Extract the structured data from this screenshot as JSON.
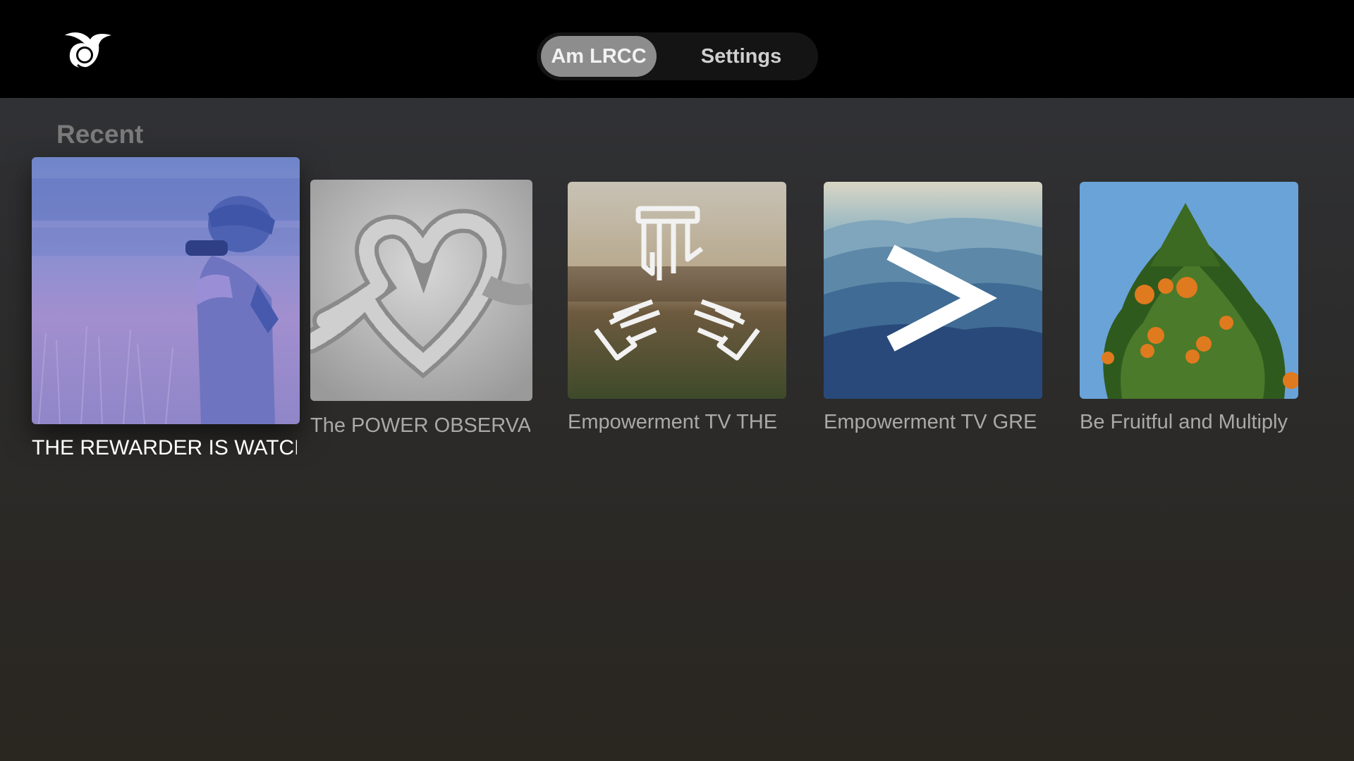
{
  "header": {
    "logo_icon": "dove-icon",
    "tabs": [
      {
        "label": "Am LRCC",
        "selected": true
      },
      {
        "label": "Settings",
        "selected": false
      }
    ]
  },
  "recent": {
    "title": "Recent",
    "items": [
      {
        "title": "THE REWARDER IS WATCH",
        "artwork": "child-binoculars-image",
        "focused": true
      },
      {
        "title": "The POWER OBSERVA",
        "artwork": "rope-heart-knot-image",
        "focused": false
      },
      {
        "title": "Empowerment TV THE",
        "artwork": "helping-hands-image",
        "focused": false
      },
      {
        "title": "Empowerment TV GRE",
        "artwork": "mountains-chevron-image",
        "focused": false
      },
      {
        "title": "Be Fruitful and Multiply",
        "artwork": "orange-tree-image",
        "focused": false
      }
    ]
  },
  "colors": {
    "topbar": "#000000",
    "active_tab": "#8d8d8d",
    "section_title": "#7a7a7a",
    "caption": "#a9a9a9",
    "caption_focused": "#ffffff"
  }
}
